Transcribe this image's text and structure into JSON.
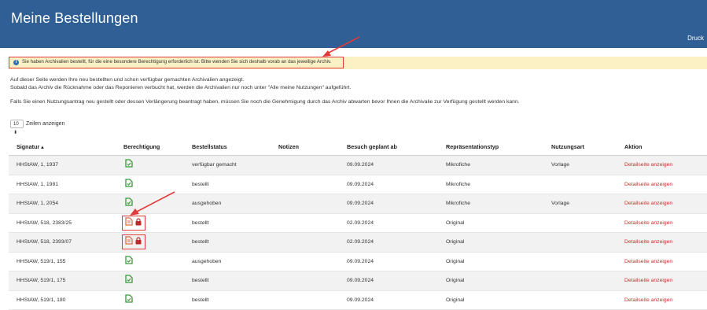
{
  "header": {
    "title": "Meine Bestellungen",
    "print_label": "Druck"
  },
  "alert": {
    "text": "Sie haben Archivalien bestellt, für die eine besondere Berechtigung erforderlich ist. Bitte wenden Sie sich deshalb vorab an das jeweilige Archiv."
  },
  "intro": {
    "line1": "Auf dieser Seite werden Ihre neu bestellten und schon verfügbar gemachten Archivalien angezeigt.",
    "line2": "Sobald das Archiv die Rücknahme oder das Reponieren verbucht hat, werden die Archivalien nur noch unter \"Alle meine Nutzungen\" aufgeführt.",
    "line3": "Falls Sie einen Nutzungsantrag neu gestellt oder dessen Verlängerung beantragt haben, müssen Sie noch die Genehmigung durch das Archiv abwarten bevor Ihnen die Archivalie zur Verfügung gestellt werden kann."
  },
  "length": {
    "value": "10 ⬍",
    "label": "Zeilen anzeigen"
  },
  "table": {
    "headers": {
      "signatur": "Signatur ▴",
      "berechtigung": "Berechtigung",
      "bestellstatus": "Bestellstatus",
      "notizen": "Notizen",
      "besuch": "Besuch geplant ab",
      "repraesentation": "Repräsentationstyp",
      "nutzungsart": "Nutzungsart",
      "aktion": "Aktion"
    },
    "rows": [
      {
        "signatur": "HHStAW, 1, 1937",
        "permission": "ok",
        "status": "verfügbar gemacht",
        "notizen": "",
        "besuch": "09.09.2024",
        "typ": "Mikrofiche",
        "nutzungsart": "Vorlage",
        "aktion": "Detailseite anzeigen"
      },
      {
        "signatur": "HHStAW, 1, 1981",
        "permission": "ok",
        "status": "bestellt",
        "notizen": "",
        "besuch": "09.09.2024",
        "typ": "Mikrofiche",
        "nutzungsart": "",
        "aktion": "Detailseite anzeigen"
      },
      {
        "signatur": "HHStAW, 1, 2054",
        "permission": "ok",
        "status": "ausgehoben",
        "notizen": "",
        "besuch": "09.09.2024",
        "typ": "Mikrofiche",
        "nutzungsart": "Vorlage",
        "aktion": "Detailseite anzeigen"
      },
      {
        "signatur": "HHStAW, 518, 2383/25",
        "permission": "restricted",
        "status": "bestellt",
        "notizen": "",
        "besuch": "02.09.2024",
        "typ": "Original",
        "nutzungsart": "",
        "aktion": "Detailseite anzeigen"
      },
      {
        "signatur": "HHStAW, 518, 2393/07",
        "permission": "restricted",
        "status": "bestellt",
        "notizen": "",
        "besuch": "02.09.2024",
        "typ": "Original",
        "nutzungsart": "",
        "aktion": "Detailseite anzeigen"
      },
      {
        "signatur": "HHStAW, 519/1, 155",
        "permission": "ok",
        "status": "ausgehoben",
        "notizen": "",
        "besuch": "09.09.2024",
        "typ": "Original",
        "nutzungsart": "",
        "aktion": "Detailseite anzeigen"
      },
      {
        "signatur": "HHStAW, 519/1, 175",
        "permission": "ok",
        "status": "bestellt",
        "notizen": "",
        "besuch": "09.09.2024",
        "typ": "Original",
        "nutzungsart": "",
        "aktion": "Detailseite anzeigen"
      },
      {
        "signatur": "HHStAW, 519/1, 180",
        "permission": "ok",
        "status": "bestellt",
        "notizen": "",
        "besuch": "09.09.2024",
        "typ": "Original",
        "nutzungsart": "",
        "aktion": "Detailseite anzeigen"
      }
    ]
  },
  "colors": {
    "header_bg": "#2f5f94",
    "alert_bg": "#fbf1c4",
    "ok_icon": "#3a9a3a",
    "restricted_icon": "#d9704a",
    "lock_icon": "#c0282c",
    "link": "#c9302c",
    "annotation": "#e03a3a"
  },
  "icons": {
    "ok": "document-check-icon",
    "restricted": "document-warning-icon",
    "lock": "lock-icon",
    "info": "info-icon"
  }
}
